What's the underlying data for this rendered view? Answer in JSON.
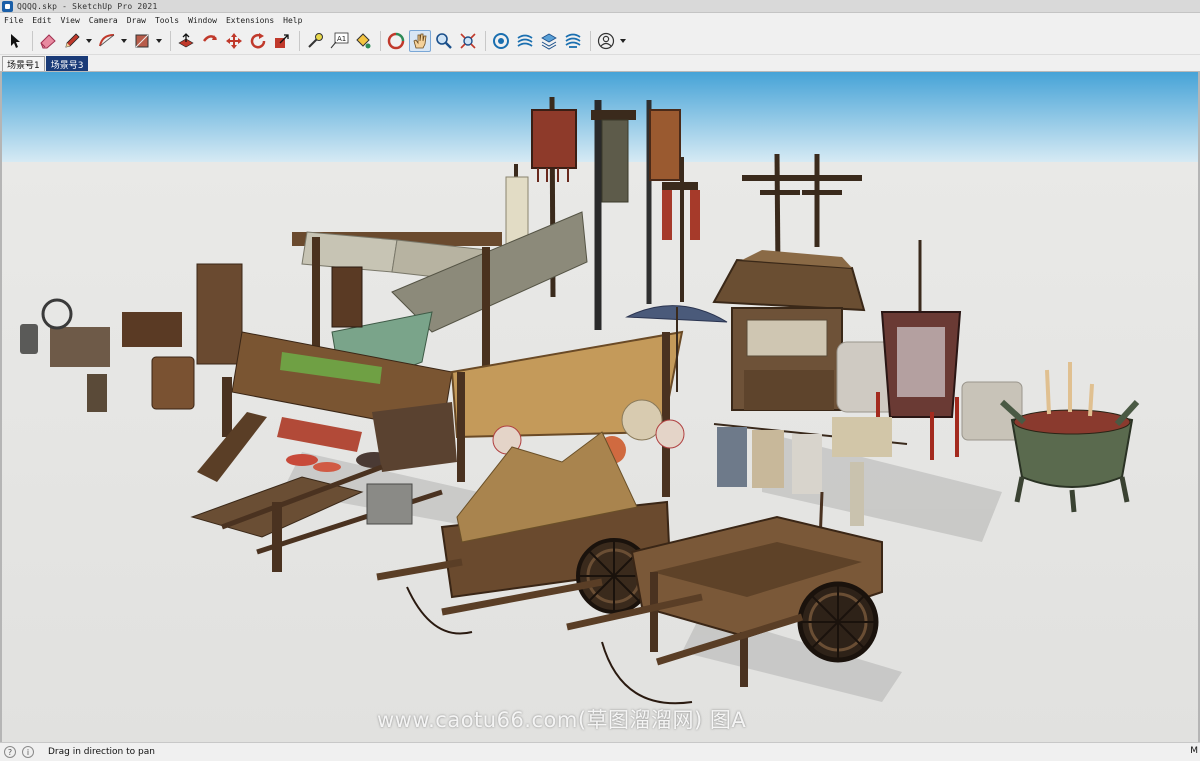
{
  "window": {
    "title": "QQQQ.skp - SketchUp Pro 2021"
  },
  "menu": [
    "File",
    "Edit",
    "View",
    "Camera",
    "Draw",
    "Tools",
    "Window",
    "Extensions",
    "Help"
  ],
  "toolbar": {
    "tools": [
      {
        "name": "select-tool",
        "icon": "arrow-cursor-icon"
      },
      {
        "name": "eraser-tool",
        "icon": "eraser-icon"
      },
      {
        "name": "line-tool",
        "icon": "pencil-icon"
      },
      {
        "name": "arc-tool",
        "icon": "arc-icon"
      },
      {
        "name": "rectangle-tool",
        "icon": "rectangle-icon"
      },
      {
        "name": "push-pull-tool",
        "icon": "push-pull-icon"
      },
      {
        "name": "move-tool",
        "icon": "move-icon"
      },
      {
        "name": "rotate-tool",
        "icon": "rotate-icon"
      },
      {
        "name": "scale-tool",
        "icon": "scale-icon"
      },
      {
        "name": "tape-measure-tool",
        "icon": "tape-measure-icon"
      },
      {
        "name": "text-tool",
        "icon": "text-icon"
      },
      {
        "name": "paint-bucket-tool",
        "icon": "paint-bucket-icon"
      },
      {
        "name": "orbit-tool",
        "icon": "orbit-icon"
      },
      {
        "name": "pan-tool",
        "icon": "hand-icon"
      },
      {
        "name": "zoom-tool",
        "icon": "magnifier-icon"
      },
      {
        "name": "zoom-extents-tool",
        "icon": "zoom-extents-icon"
      },
      {
        "name": "3d-warehouse",
        "icon": "warehouse-icon"
      },
      {
        "name": "extension-warehouse",
        "icon": "extension-warehouse-icon"
      },
      {
        "name": "layout",
        "icon": "layout-icon"
      },
      {
        "name": "extension-manager",
        "icon": "extension-manager-icon"
      },
      {
        "name": "account",
        "icon": "user-icon"
      }
    ],
    "text_tool_label": "A1"
  },
  "scenes": [
    "场景号1",
    "场景号3"
  ],
  "active_scene": "场景号3",
  "watermark": "www.caotu66.com(草图溜溜网) 图A",
  "status": {
    "message": "Drag in direction to pan",
    "right_label": "M"
  },
  "colors": {
    "sky_top": "#4aa6d8",
    "sky_bottom": "#d3e8f3",
    "ground": "#e4e4e2",
    "scene_tab_active": "#1a3b78"
  }
}
